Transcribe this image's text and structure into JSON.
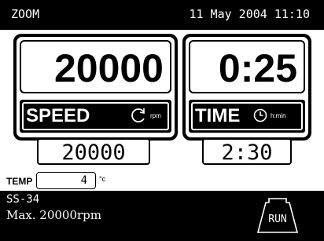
{
  "header": {
    "mode": "ZOOM",
    "datetime": "11 May 2004 11:10"
  },
  "speed": {
    "actual": "20000",
    "label": "SPEED",
    "unit": "rpm",
    "setpoint": "20000"
  },
  "time": {
    "actual": "0:25",
    "label": "TIME",
    "unit": "h:min",
    "setpoint": "2:30"
  },
  "temp": {
    "label": "TEMP",
    "value": "4",
    "unit": "°c"
  },
  "rotor": {
    "name": "SS-34",
    "max_speed": "Max. 20000rpm"
  },
  "run_button": {
    "label": "RUN"
  }
}
